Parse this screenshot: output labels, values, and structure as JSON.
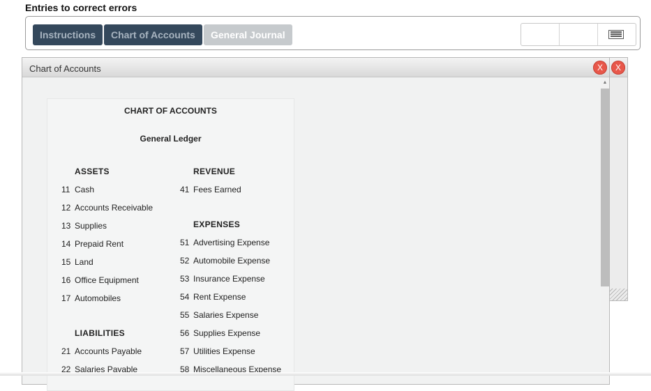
{
  "page_title": "Entries to correct errors",
  "tabs": [
    {
      "label": "Instructions"
    },
    {
      "label": "Chart of Accounts"
    },
    {
      "label": "General Journal"
    }
  ],
  "window": {
    "title": "Chart of Accounts",
    "close_label": "X",
    "outer_close_label": "X"
  },
  "coa": {
    "heading": "CHART OF ACCOUNTS",
    "subheading": "General Ledger",
    "assets": {
      "label": "ASSETS",
      "items": [
        {
          "num": "11",
          "name": "Cash"
        },
        {
          "num": "12",
          "name": "Accounts Receivable"
        },
        {
          "num": "13",
          "name": "Supplies"
        },
        {
          "num": "14",
          "name": "Prepaid Rent"
        },
        {
          "num": "15",
          "name": "Land"
        },
        {
          "num": "16",
          "name": "Office Equipment"
        },
        {
          "num": "17",
          "name": "Automobiles"
        }
      ]
    },
    "liabilities": {
      "label": "LIABILITIES",
      "items": [
        {
          "num": "21",
          "name": "Accounts Payable"
        },
        {
          "num": "22",
          "name": "Salaries Payable"
        }
      ]
    },
    "revenue": {
      "label": "REVENUE",
      "items": [
        {
          "num": "41",
          "name": "Fees Earned"
        }
      ]
    },
    "expenses": {
      "label": "EXPENSES",
      "items": [
        {
          "num": "51",
          "name": "Advertising Expense"
        },
        {
          "num": "52",
          "name": "Automobile Expense"
        },
        {
          "num": "53",
          "name": "Insurance Expense"
        },
        {
          "num": "54",
          "name": "Rent Expense"
        },
        {
          "num": "55",
          "name": "Salaries Expense"
        },
        {
          "num": "56",
          "name": "Supplies Expense"
        },
        {
          "num": "57",
          "name": "Utilities Expense"
        },
        {
          "num": "58",
          "name": "Miscellaneous Expense"
        }
      ]
    }
  },
  "icons": {
    "menu": "hamburger-menu-icon",
    "scroll_up": "scroll-up-arrow-icon"
  },
  "colors": {
    "tab_dark": "#34485c",
    "tab_active": "#c6cacd",
    "close_button": "#e8574a"
  }
}
